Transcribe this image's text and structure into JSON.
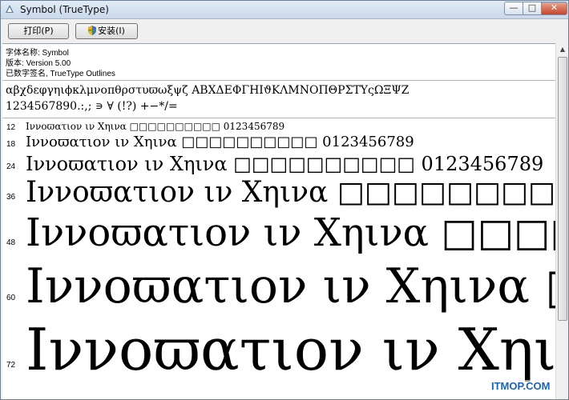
{
  "window": {
    "title": "Symbol (TrueType)",
    "min_glyph": "—",
    "max_glyph": "□",
    "close_glyph": "✕"
  },
  "toolbar": {
    "print_label": "打印(P)",
    "install_label": "安装(I)"
  },
  "font_info": {
    "name_line": "字体名称: Symbol",
    "version_line": "版本: Version 5.00",
    "signature_line": "已数字签名, TrueType Outlines"
  },
  "charset": {
    "line1": "αβχδεφγηιϕκλμνοπθρστυϖωξψζ ΑΒΧΔΕΦΓΗΙϑΚΛΜΝΟΠΘΡΣΤΥςΩΞΨΖ",
    "line2": "1234567890.:,; ∍ ∀ (!?) +−*/="
  },
  "samples": {
    "text": "Ιννοϖατιον ιν Χηινα □□□□□□□□□□ 0123456789",
    "rows": [
      {
        "size": "12"
      },
      {
        "size": "18"
      },
      {
        "size": "24"
      },
      {
        "size": "36"
      },
      {
        "size": "48"
      },
      {
        "size": "60"
      },
      {
        "size": "72"
      }
    ]
  },
  "scrollbar": {
    "up_glyph": "▲"
  },
  "watermark": "ITMOP.COM",
  "colors": {
    "titlebar": "#d6e2f0",
    "close_button": "#c5442c",
    "watermark": "#1b64b8"
  }
}
